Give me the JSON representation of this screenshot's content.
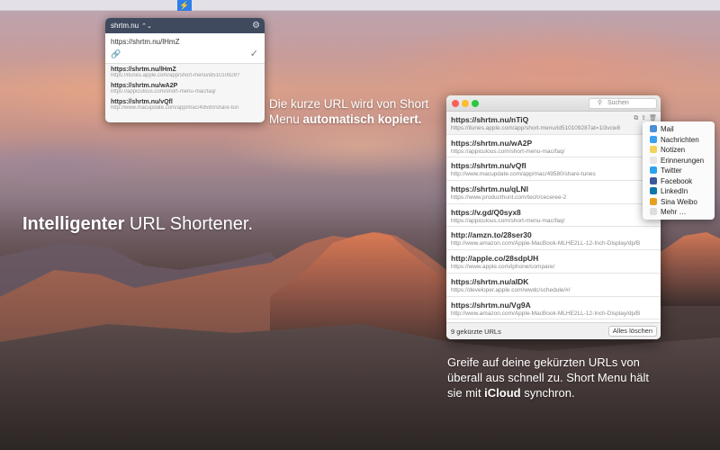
{
  "menubar": {
    "app_icon": "lightning-icon"
  },
  "popover": {
    "account": "shrtm.nu",
    "input_value": "https://shrtm.nu/lHmZ",
    "items": [
      {
        "short": "https://shrtm.nu/lHmZ",
        "long": "https://itunes.apple.com/app/short-menu/id51010928?"
      },
      {
        "short": "https://shrtm.nu/wA2P",
        "long": "https://appiculous.com/short-menu-mac/faq/"
      },
      {
        "short": "https://shrtm.nu/vQfl",
        "long": "http://www.macupdate.com/app/mac/49580/share-tun"
      }
    ]
  },
  "captions": {
    "top_text": "Die kurze URL wird von Short Menu ",
    "top_bold": "automatisch kopiert.",
    "headline_bold": "Intelligenter",
    "headline_rest": " URL Shortener.",
    "bottom_text_1": "Greife auf deine gekürzten URLs von überall aus schnell zu. Short Menu hält sie mit ",
    "bottom_bold": "iCloud",
    "bottom_text_2": " synchron."
  },
  "window": {
    "search_placeholder": "Suchen",
    "rows": [
      {
        "short": "https://shrtm.nu/nTiQ",
        "long": "https://itunes.apple.com/app/short-menu/id510109287at=1l3vcw8"
      },
      {
        "short": "https://shrtm.nu/wA2P",
        "long": "https://appiculous.com/short-menu-mac/faq/"
      },
      {
        "short": "https://shrtm.nu/vQfl",
        "long": "http://www.macupdate.com/app/mac/49580/share-tunes"
      },
      {
        "short": "https://shrtm.nu/qLNI",
        "long": "https://www.producthunt.com/tech/ceceree-2"
      },
      {
        "short": "https://v.gd/Q0syx8",
        "long": "https://appiculous.com/short-menu-mac/faq/"
      },
      {
        "short": "http://amzn.to/28ser30",
        "long": "http://www.amazon.com/Apple-MacBook-MLHE2LL-12-Inch-Display/dp/B"
      },
      {
        "short": "http://apple.co/28sdpUH",
        "long": "https://www.apple.com/iphone/compare/"
      },
      {
        "short": "https://shrtm.nu/aIDK",
        "long": "https://developer.apple.com/wwdc/schedule/#/"
      },
      {
        "short": "https://shrtm.nu/Vg9A",
        "long": "http://www.amazon.com/Apple-MacBook-MLHE2LL-12-Inch-Display/dp/B"
      }
    ],
    "count_label": "9 gekürzte URLs",
    "clear_button": "Alles löschen"
  },
  "share_menu": {
    "items": [
      {
        "label": "Mail",
        "icon": "mail-icon",
        "color": "#4a90d9"
      },
      {
        "label": "Nachrichten",
        "icon": "messages-icon",
        "color": "#3aa0f0"
      },
      {
        "label": "Notizen",
        "icon": "notes-icon",
        "color": "#f5d35a"
      },
      {
        "label": "Erinnerungen",
        "icon": "reminders-icon",
        "color": "#e6e6e6"
      },
      {
        "label": "Twitter",
        "icon": "twitter-icon",
        "color": "#2aa3ef"
      },
      {
        "label": "Facebook",
        "icon": "facebook-icon",
        "color": "#3b5998"
      },
      {
        "label": "LinkedIn",
        "icon": "linkedin-icon",
        "color": "#0e76a8"
      },
      {
        "label": "Sina Weibo",
        "icon": "weibo-icon",
        "color": "#e6a020"
      },
      {
        "label": "Mehr …",
        "icon": "more-icon",
        "color": "#dddddd"
      }
    ]
  }
}
